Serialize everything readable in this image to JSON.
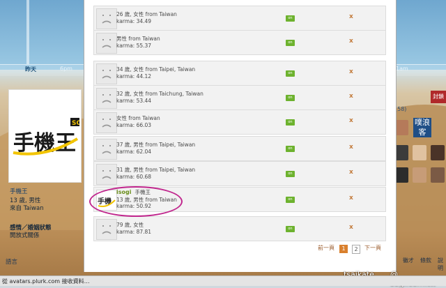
{
  "timeline": {
    "today": "昨天",
    "pm6": "6pm",
    "am1": "1am"
  },
  "profile": {
    "name": "手機王",
    "info_line1": "13 歲, 男性",
    "info_line2": "來自 Taiwan",
    "relationship_label": "感情／婚姻狀態",
    "relationship_value": "開放式關係"
  },
  "language_label": "語言",
  "right_panel": {
    "action_button": "封鎖",
    "fans_count": "(58)",
    "plurk_badge": "噗浪客",
    "bottom_links": [
      "徽才",
      "條款",
      "說明"
    ]
  },
  "friend_list": {
    "rows": [
      {
        "line1": "26 歲, 女性 from Taiwan",
        "karma": "karma: 34.49",
        "on_label": "on",
        "remove_label": "x"
      },
      {
        "line1": "男性 from Taiwan",
        "karma": "karma: 55.37",
        "on_label": "on",
        "remove_label": "x"
      },
      {
        "line1": "34 歲, 女性 from Taipei, Taiwan",
        "karma": "karma: 44.12",
        "on_label": "on",
        "remove_label": "x"
      },
      {
        "line1": "32 歲, 女性 from Taichung, Taiwan",
        "karma": "karma: 53.44",
        "on_label": "on",
        "remove_label": "x"
      },
      {
        "line1": "女性 from Taiwan",
        "karma": "karma: 66.03",
        "on_label": "on",
        "remove_label": "x"
      },
      {
        "line1": "37 歲, 男性 from Taipei, Taiwan",
        "karma": "karma: 62.04",
        "on_label": "on",
        "remove_label": "x"
      },
      {
        "line1": "31 歲, 男性 from Taipei, Taiwan",
        "karma": "karma: 60.68",
        "on_label": "on",
        "remove_label": "x"
      },
      {
        "nick": "isogi",
        "display_name": "手機王",
        "line1": "13 歲, 男性 from Taiwan",
        "karma": "karma: 50.92",
        "on_label": "on",
        "remove_label": "x"
      },
      {
        "line1": "79 歲, 女性",
        "karma": "karma: 87.81",
        "on_label": "on",
        "remove_label": "x"
      }
    ]
  },
  "pagination": {
    "prev": "前一頁",
    "page1": "1",
    "page2": "2",
    "next": "下一頁"
  },
  "status_bar": {
    "text": "從 avatars.plurk.com 接收資料…"
  },
  "watermark": {
    "user": "tsaikate",
    "site": "@ sogi.com.tw"
  },
  "colors": {
    "on_button": "#6db22e",
    "highlight_circle": "#c0268d",
    "page_active": "#d9802e",
    "remove_x": "#c27a3a"
  }
}
